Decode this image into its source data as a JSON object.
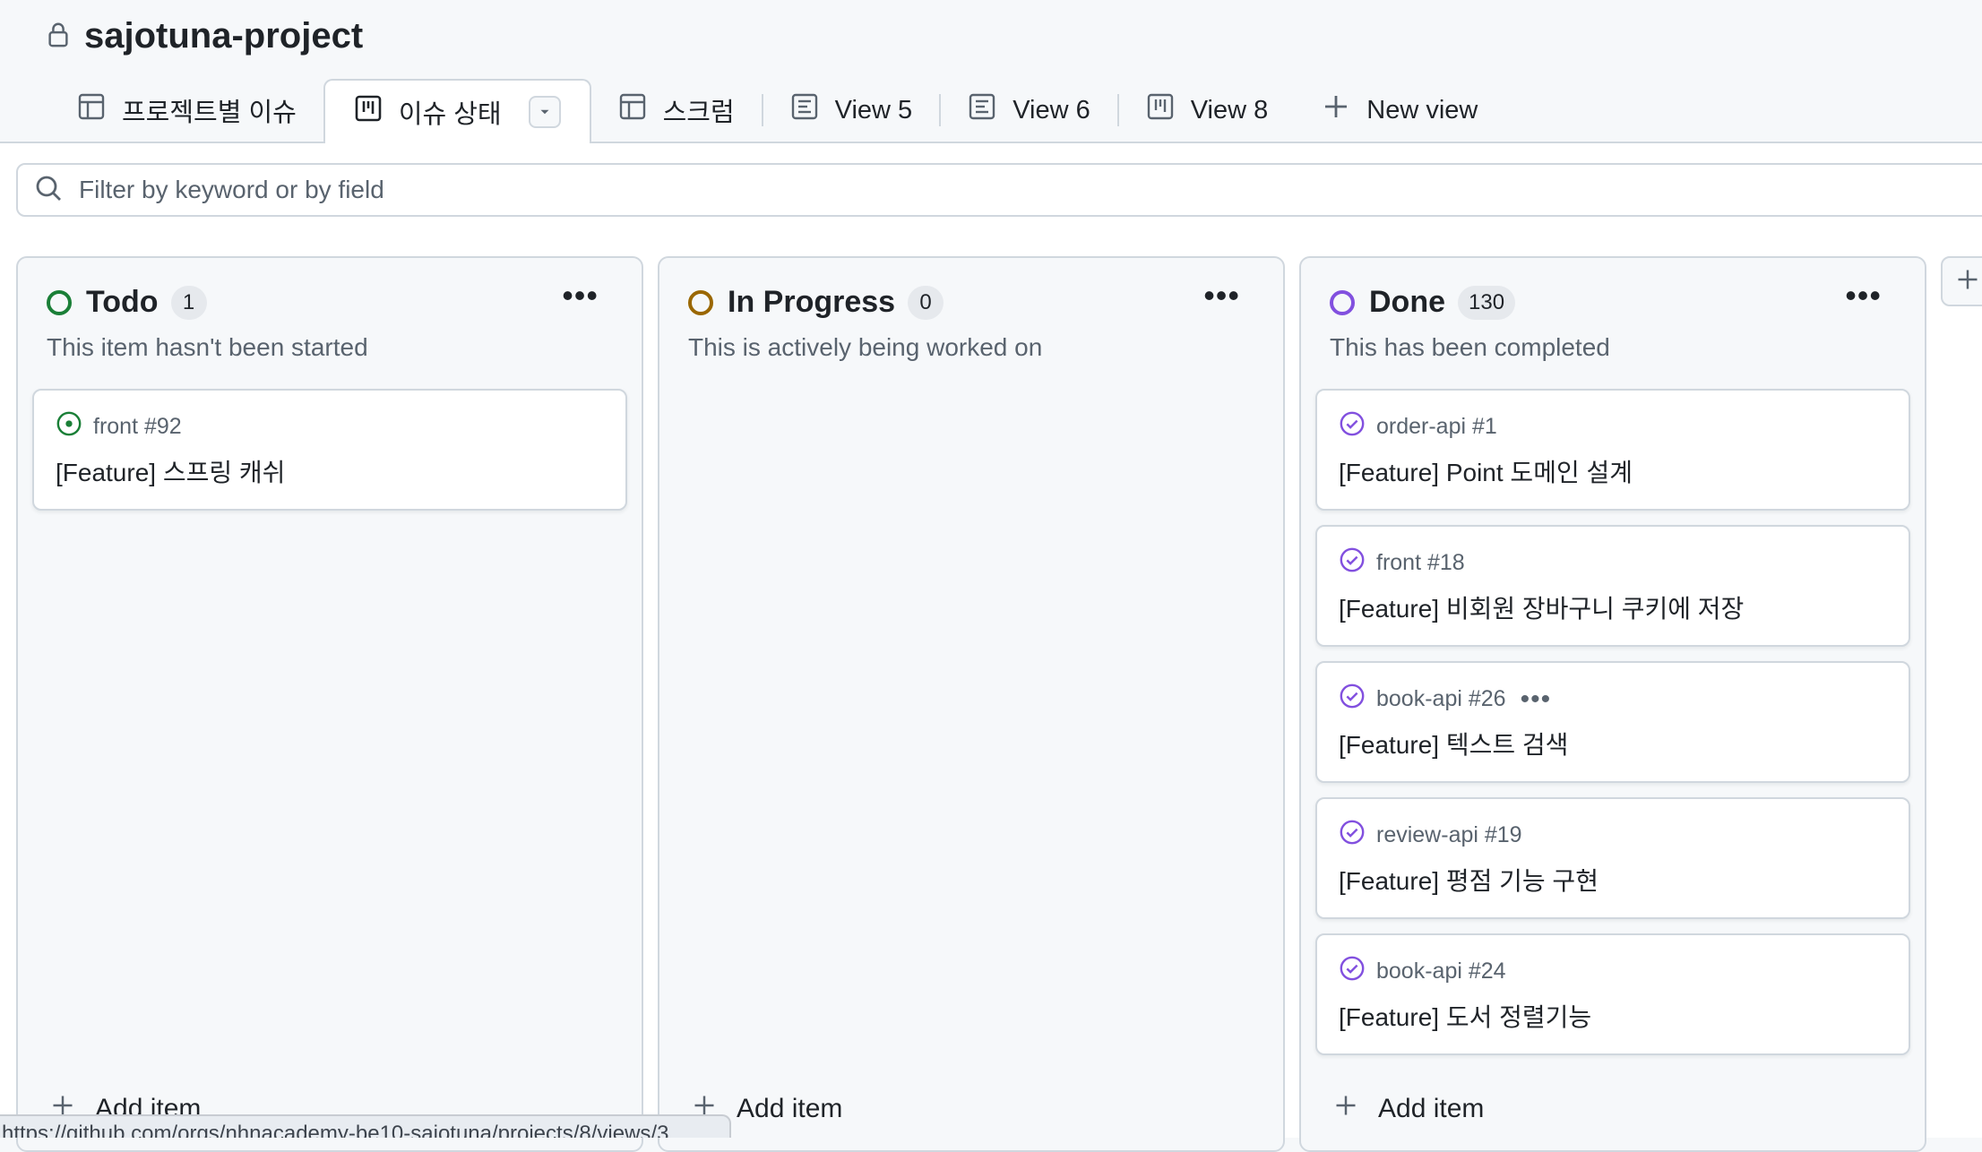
{
  "project": {
    "title": "sajotuna-project",
    "icon": "lock-icon"
  },
  "tabs": [
    {
      "label": "프로젝트별 이슈",
      "icon": "table-icon",
      "active": false
    },
    {
      "label": "이슈 상태",
      "icon": "board-icon",
      "active": true
    },
    {
      "label": "스크럼",
      "icon": "table-icon",
      "active": false
    },
    {
      "label": "View 5",
      "icon": "roadmap-icon",
      "active": false
    },
    {
      "label": "View 6",
      "icon": "roadmap-icon",
      "active": false
    },
    {
      "label": "View 8",
      "icon": "board-icon",
      "active": false
    }
  ],
  "new_view_label": "New view",
  "filter": {
    "placeholder": "Filter by keyword or by field"
  },
  "columns": [
    {
      "name": "Todo",
      "count": "1",
      "color": "#1a7f37",
      "description": "This item hasn't been started",
      "cards": [
        {
          "meta": "front #92",
          "title": "[Feature] 스프링 캐쉬",
          "state": "open"
        }
      ],
      "add_label": "Add item"
    },
    {
      "name": "In Progress",
      "count": "0",
      "color": "#9a6700",
      "description": "This is actively being worked on",
      "cards": [],
      "add_label": "Add item"
    },
    {
      "name": "Done",
      "count": "130",
      "color": "#8250df",
      "description": "This has been completed",
      "cards": [
        {
          "meta": "order-api #1",
          "title": "[Feature] Point 도메인 설계",
          "state": "closed"
        },
        {
          "meta": "front #18",
          "title": "[Feature] 비회원 장바구니 쿠키에 저장",
          "state": "closed"
        },
        {
          "meta": "book-api #26",
          "title": "[Feature] 텍스트 검색",
          "state": "closed",
          "hovered": true
        },
        {
          "meta": "review-api #19",
          "title": "[Feature] 평점 기능 구현",
          "state": "closed"
        },
        {
          "meta": "book-api #24",
          "title": "[Feature] 도서 정렬기능",
          "state": "closed"
        }
      ],
      "add_label": "Add item"
    }
  ],
  "status_url": "https://github.com/orgs/nhnacademy-be10-sajotuna/projects/8/views/3"
}
